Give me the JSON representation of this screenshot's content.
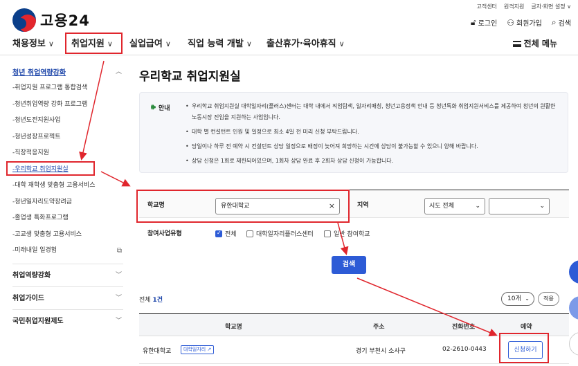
{
  "header": {
    "logo_text": "고용24",
    "util_links": [
      "고객센터",
      "원격지원",
      "글자·화면 설정 ∨"
    ],
    "top_links": [
      {
        "icon": "lock-icon",
        "label": "로그인"
      },
      {
        "icon": "user-icon",
        "label": "회원가입"
      },
      {
        "icon": "search-icon",
        "label": "검색"
      }
    ]
  },
  "gnb": {
    "menus": [
      "채용정보",
      "취업지원",
      "실업급여",
      "직업 능력 개발",
      "출산휴가·육아휴직"
    ],
    "all_menu": "전체 메뉴"
  },
  "sidebar": {
    "head": "청년 취업역량강화",
    "items": [
      "취업지원 프로그램 통합검색",
      "청년취업역량 강화 프로그램",
      "청년도전지원사업",
      "청년성장프로젝트",
      "직장적응지원",
      "우리학교 취업지원실",
      "대학 재학생 맞춤형 고용서비스",
      "청년일자리도약장려금",
      "졸업생 특화프로그램",
      "고교생 맞춤형 고용서비스",
      "미래내일 일경험"
    ],
    "sections": [
      "취업역량강화",
      "취업가이드",
      "국민취업지원제도"
    ]
  },
  "main": {
    "title": "우리학교 취업지원실",
    "notice": {
      "label": "안내",
      "items": [
        "우리학교 취업지원실 대학일자리(플러스)센터는 대학 내에서 직업탐색, 일자리매칭, 청년고용정책 안내 등 청년특화 취업지원서비스를 제공하여 청년의 원활한 노동시장 진입을 지원하는 사업입니다.",
        "대학 별 컨설턴트 인원 및 일정으로 최소 4일 전 미리 신청 부탁드립니다.",
        "당일이나 하루 전 예약 시 컨설턴트 상담 일정으로 배정이 늦어져 희망하는 시간에 상담이 불가능할 수 있으니 양해 바랍니다.",
        "상담 신청은 1회로 제한되어있으며, 1회차 상담 완료 후 2회차 상담 신청이 가능합니다."
      ]
    },
    "search": {
      "school_label": "학교명",
      "school_value": "유한대학교",
      "region_label": "지역",
      "region_select": "시도 전체",
      "region_sub_select": "",
      "type_label": "참여사업유형",
      "options": [
        "전체",
        "대학일자리플러스센터",
        "일반 참여학교"
      ],
      "checked": [
        true,
        false,
        false
      ],
      "button": "검색"
    },
    "results": {
      "total_prefix": "전체",
      "total_count": "1건",
      "per_page": "10개",
      "apply_label": "적용",
      "columns": [
        "학교명",
        "주소",
        "전화번호",
        "예약"
      ],
      "rows": [
        {
          "name": "유한대학교",
          "tag": "대학일자리",
          "address": "경기 부천시 소사구",
          "phone": "02-2610-0443",
          "action": "신청하기"
        }
      ]
    }
  },
  "colors": {
    "accent": "#2d5bd6",
    "annotation": "#e0262d",
    "link": "#1a43a8"
  }
}
